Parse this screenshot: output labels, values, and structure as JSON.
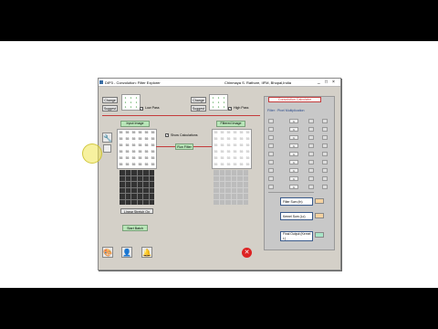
{
  "window": {
    "title": "DIP3 - Convolution: Filter Explorer",
    "author": "Chinmaya S. Rathore, IIFM, Bhopal,India",
    "min": "_",
    "max": "□",
    "close": "×"
  },
  "top": {
    "change_left": "Change",
    "suggest_left": "Suggest",
    "low_pass": "Low Pass",
    "change_right": "Change",
    "suggest_right": "Suggest",
    "high_pass": "High Pass",
    "kernel_left": [
      "1",
      "1",
      "1",
      "1",
      "1",
      "1",
      "1",
      "1",
      "1"
    ],
    "kernel_right": [
      "1",
      "1",
      "1",
      "1",
      "1",
      "1",
      "1",
      "1",
      "1"
    ]
  },
  "input": {
    "caption": "Input Image",
    "grid": [
      "55",
      "55",
      "55",
      "55",
      "55",
      "55",
      "55",
      "55",
      "55",
      "55",
      "55",
      "55",
      "55",
      "55",
      "55",
      "55",
      "55",
      "55",
      "55",
      "55",
      "55",
      "55",
      "55",
      "55",
      "55",
      "55",
      "55",
      "55",
      "55",
      "55",
      "55",
      "55",
      "55",
      "55",
      "55",
      "55"
    ],
    "stretch_label": "Linear Stretch On"
  },
  "middle": {
    "show_calc": "Show Calculations",
    "run_filter": "Run Filter"
  },
  "filtered": {
    "caption": "Filtered Image",
    "grid": [
      "55",
      "55",
      "55",
      "55",
      "55",
      "55",
      "55",
      "55",
      "55",
      "55",
      "55",
      "55",
      "55",
      "55",
      "55",
      "55",
      "55",
      "55",
      "55",
      "55",
      "55",
      "55",
      "55",
      "55",
      "55",
      "55",
      "55",
      "55",
      "55",
      "55",
      "55",
      "55",
      "55",
      "55",
      "55",
      "55"
    ]
  },
  "start_button": "Start Batch",
  "side": {
    "title": "Convolution Calculator",
    "subtitle": "Filter : Pixel Multiplication",
    "rows": [
      "1",
      "1",
      "1",
      "1",
      "1",
      "1",
      "1",
      "1",
      "1"
    ],
    "sum_label": "Filter Sum (fn)",
    "kernel_sum_label": "Kernel Sum (Lc)",
    "result_label": "Final Output (Kernel L)"
  },
  "colors": {
    "accent_red": "#c43c3c",
    "green_button": "#b8e6b8",
    "swatch_orange": "#f5d2a0",
    "swatch_green": "#a8e6c8"
  },
  "icons": {
    "left_tool": "wrench-icon",
    "zoom": "magnifier-icon",
    "bottom_1": "paint-icon",
    "bottom_2": "person-icon",
    "bottom_3": "bell-icon",
    "exit": "close-icon"
  }
}
